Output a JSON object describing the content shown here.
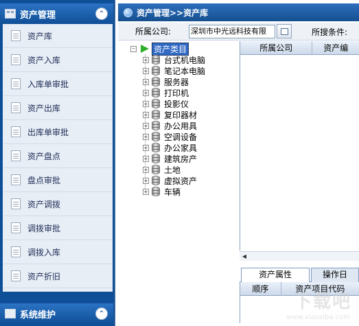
{
  "sidebar": {
    "header": "资产管理",
    "items": [
      {
        "label": "资产库"
      },
      {
        "label": "资产入库"
      },
      {
        "label": "入库单审批"
      },
      {
        "label": "资产出库"
      },
      {
        "label": "出库单审批"
      },
      {
        "label": "资产盘点"
      },
      {
        "label": "盘点审批"
      },
      {
        "label": "资产调拨"
      },
      {
        "label": "调拨审批"
      },
      {
        "label": "调拨入库"
      },
      {
        "label": "资产折旧"
      }
    ],
    "bottom_header": "系统维护"
  },
  "main": {
    "title": "资产管理>>资产库",
    "filter": {
      "company_label": "所属公司:",
      "company_value": "深圳市中光远科技有限",
      "condition_label": "所搜条件:"
    },
    "tree": {
      "root": "资产类目",
      "nodes": [
        "台式机电脑",
        "笔记本电脑",
        "服务器",
        "打印机",
        "投影仪",
        "复印器材",
        "办公用具",
        "空调设备",
        "办公家具",
        "建筑房产",
        "土地",
        "虚拟资产",
        "车辆"
      ]
    },
    "grid": {
      "columns": [
        "所属公司",
        "资产编"
      ]
    },
    "tabs": [
      "资产属性",
      "操作日"
    ],
    "grid2": {
      "columns": [
        "顺序",
        "资产项目代码"
      ]
    }
  },
  "colors": {
    "sidebar_bg": "#0f4f97",
    "sidebar_list_bg": "#e8eef6",
    "title_bar": "#15508f",
    "selection": "#316ac5",
    "arrow": "#e0362b"
  }
}
